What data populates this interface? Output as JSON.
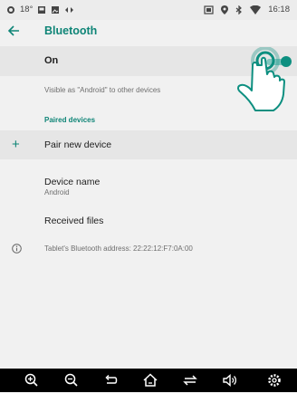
{
  "status_bar": {
    "temperature": "18°",
    "time": "16:18",
    "icons": [
      "weather-icon",
      "image-icon",
      "gallery-icon",
      "cast-icon",
      "screenshot-icon",
      "location-icon",
      "bluetooth-icon",
      "wifi-icon"
    ]
  },
  "app_bar": {
    "title": "Bluetooth"
  },
  "toggle": {
    "label": "On",
    "state": "on"
  },
  "visible_text": "Visible as \"Android\" to other devices",
  "section_header": "Paired devices",
  "pair": {
    "icon": "+",
    "label": "Pair new device"
  },
  "device": {
    "title": "Device name",
    "value": "Android"
  },
  "received": "Received files",
  "address": "Tablet's Bluetooth address: 22:22:12:F7:0A:00",
  "nav_icons": [
    "zoom-in-icon",
    "zoom-out-icon",
    "back-icon",
    "home-icon",
    "recent-apps-icon",
    "volume-icon",
    "settings-icon"
  ],
  "colors": {
    "accent": "#0f8577",
    "track": "#83c7bf",
    "row_highlight": "#e6e6e6"
  }
}
